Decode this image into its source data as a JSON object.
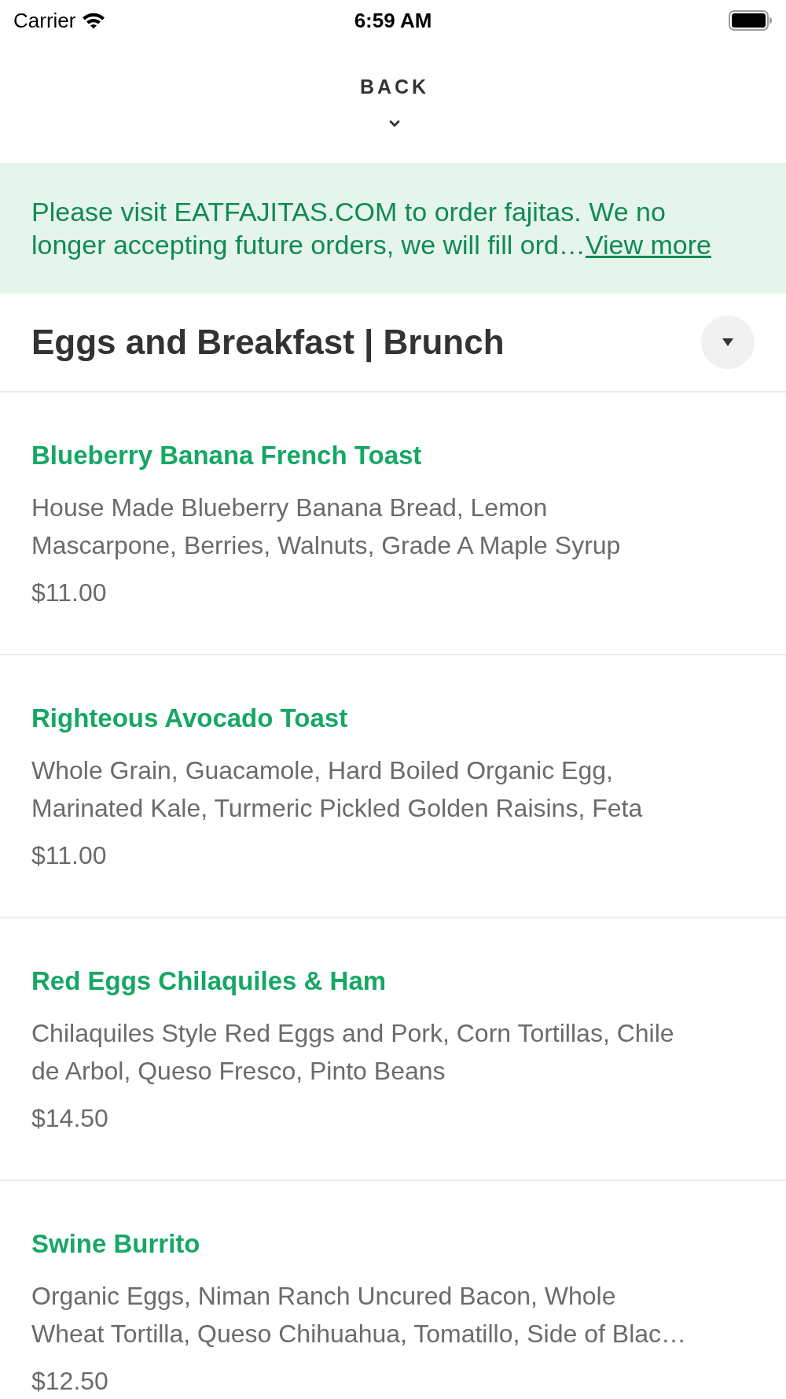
{
  "status_bar": {
    "carrier": "Carrier",
    "time": "6:59 AM"
  },
  "back_button": {
    "label": "BACK"
  },
  "notice": {
    "text": "Please visit EATFAJITAS.COM to order fajitas. We no longer accepting future orders, we will fill ord…",
    "link": "View more"
  },
  "category": {
    "title": "Eggs and Breakfast | Brunch"
  },
  "menu_items": [
    {
      "name": "Blueberry Banana French Toast",
      "description": "House Made Blueberry Banana Bread, Lemon Mascarpone, Berries, Walnuts, Grade A Maple Syrup",
      "price": "$11.00"
    },
    {
      "name": "Righteous Avocado Toast",
      "description": "Whole Grain, Guacamole, Hard Boiled Organic Egg, Marinated Kale, Turmeric Pickled Golden Raisins, Feta",
      "price": "$11.00"
    },
    {
      "name": "Red Eggs Chilaquiles & Ham",
      "description": "Chilaquiles Style Red Eggs and Pork, Corn Tortillas, Chile de Arbol, Queso Fresco, Pinto Beans",
      "price": "$14.50"
    },
    {
      "name": "Swine Burrito",
      "description": "Organic Eggs, Niman Ranch Uncured Bacon, Whole Wheat Tortilla, Queso Chihuahua, Tomatillo, Side of Blac…",
      "price": "$12.50"
    }
  ]
}
